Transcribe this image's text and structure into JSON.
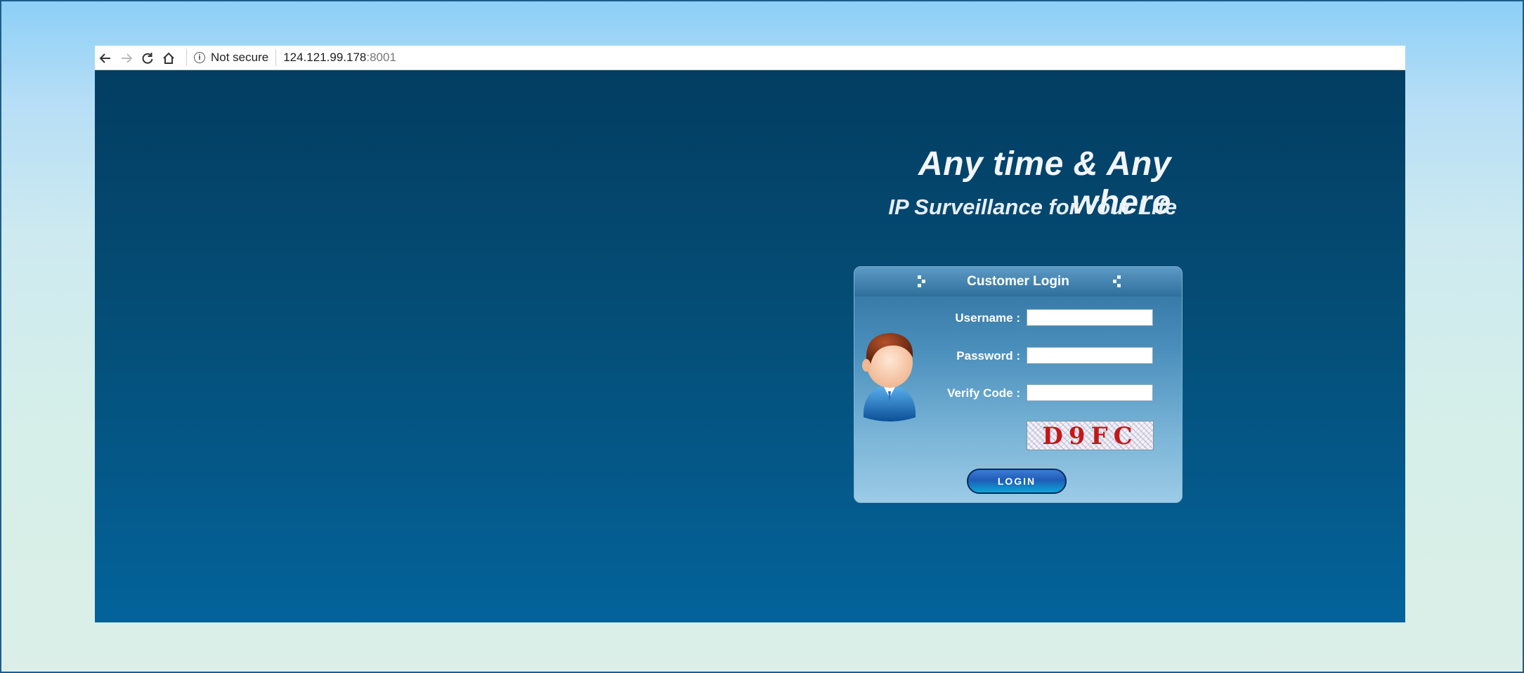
{
  "browser": {
    "security_label": "Not secure",
    "url_host": "124.121.99.178",
    "url_port": ":8001"
  },
  "page": {
    "headline": "Any time & Any where",
    "subheadline": "IP Surveillance for Your Life"
  },
  "login": {
    "title": "Customer Login",
    "username_label": "Username :",
    "password_label": "Password :",
    "verify_label": "Verify Code :",
    "captcha_code": "D9FC",
    "button_label": "LOGIN"
  }
}
